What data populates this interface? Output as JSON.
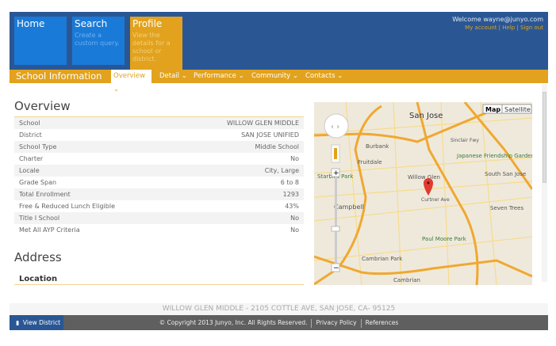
{
  "header": {
    "tiles": [
      {
        "title": "Home",
        "desc": ""
      },
      {
        "title": "Search",
        "desc": "Create a custom query."
      },
      {
        "title": "Profile",
        "desc": "View the details for a school or district."
      }
    ],
    "welcome": "Welcome wayne@junyo.com",
    "links": {
      "account": "My account",
      "help": "Help",
      "signout": "Sign out"
    }
  },
  "nav": {
    "title": "School Information",
    "items": [
      "Overview",
      "Detail",
      "Performance",
      "Community",
      "Contacts"
    ],
    "active": "Overview"
  },
  "overview": {
    "title": "Overview",
    "rows": [
      {
        "label": "School",
        "value": "WILLOW GLEN MIDDLE"
      },
      {
        "label": "District",
        "value": "SAN JOSE UNIFIED"
      },
      {
        "label": "School Type",
        "value": "Middle School"
      },
      {
        "label": "Charter",
        "value": "No"
      },
      {
        "label": "Locale",
        "value": "City, Large"
      },
      {
        "label": "Grade Span",
        "value": "6 to 8"
      },
      {
        "label": "Total Enrollment",
        "value": "1293"
      },
      {
        "label": "Free & Reduced Lunch Eligible",
        "value": "43%"
      },
      {
        "label": "Title I School",
        "value": "No"
      },
      {
        "label": "Met All AYP Criteria",
        "value": "No"
      }
    ]
  },
  "address": {
    "title": "Address",
    "location": "Location"
  },
  "map": {
    "type_map": "Map",
    "type_satellite": "Satellite",
    "labels": [
      "San Jose",
      "Burbank",
      "Fruitdale",
      "Japanese Friendship Garden",
      "South San Jose",
      "Willow Glen",
      "Campbell",
      "Starbird Park",
      "Seven Trees",
      "Paul Moore Park",
      "Cambrian Park",
      "Cambrian",
      "Sinclair Fwy",
      "Curtner Ave"
    ],
    "colors": {
      "road": "#f6c342",
      "highway": "#f0a830",
      "pin": "#e03b30"
    }
  },
  "footer": {
    "address": "WILLOW GLEN MIDDLE - 2105 COTTLE AVE, SAN JOSE, CA- 95125",
    "view_district": "View District",
    "copyright": "© Copyright 2013 Junyo, Inc. All Rights Reserved.",
    "privacy": "Privacy Policy",
    "references": "References"
  }
}
